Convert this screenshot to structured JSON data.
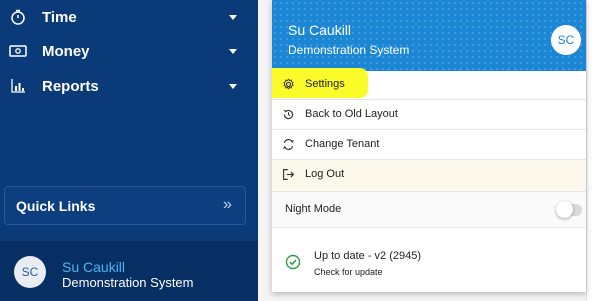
{
  "sidebar": {
    "nav": [
      {
        "label": "Time",
        "icon": "stopwatch-icon"
      },
      {
        "label": "Money",
        "icon": "money-icon"
      },
      {
        "label": "Reports",
        "icon": "bar-chart-icon"
      }
    ],
    "quick_links": {
      "label": "Quick Links",
      "chevron": "»"
    },
    "footer": {
      "initials": "SC",
      "name": "Su Caukill",
      "system": "Demonstration System"
    }
  },
  "menu": {
    "header": {
      "name": "Su Caukill",
      "system": "Demonstration System",
      "initials": "SC"
    },
    "items": [
      {
        "label": "Settings",
        "icon": "gear-icon",
        "highlighted": true
      },
      {
        "label": "Back to Old Layout",
        "icon": "history-icon"
      },
      {
        "label": "Change Tenant",
        "icon": "swap-icon"
      },
      {
        "label": "Log Out",
        "icon": "logout-icon"
      }
    ],
    "night_mode": {
      "label": "Night Mode",
      "enabled": false
    },
    "update": {
      "status": "Up to date - v2 (2945)",
      "link": "Check for update"
    }
  },
  "colors": {
    "sidebar_bg": "#0b3a78",
    "header_bg": "#1b86d3",
    "highlight": "#fbfb2a",
    "accent_name": "#4db3ef",
    "success": "#2e9e47"
  }
}
